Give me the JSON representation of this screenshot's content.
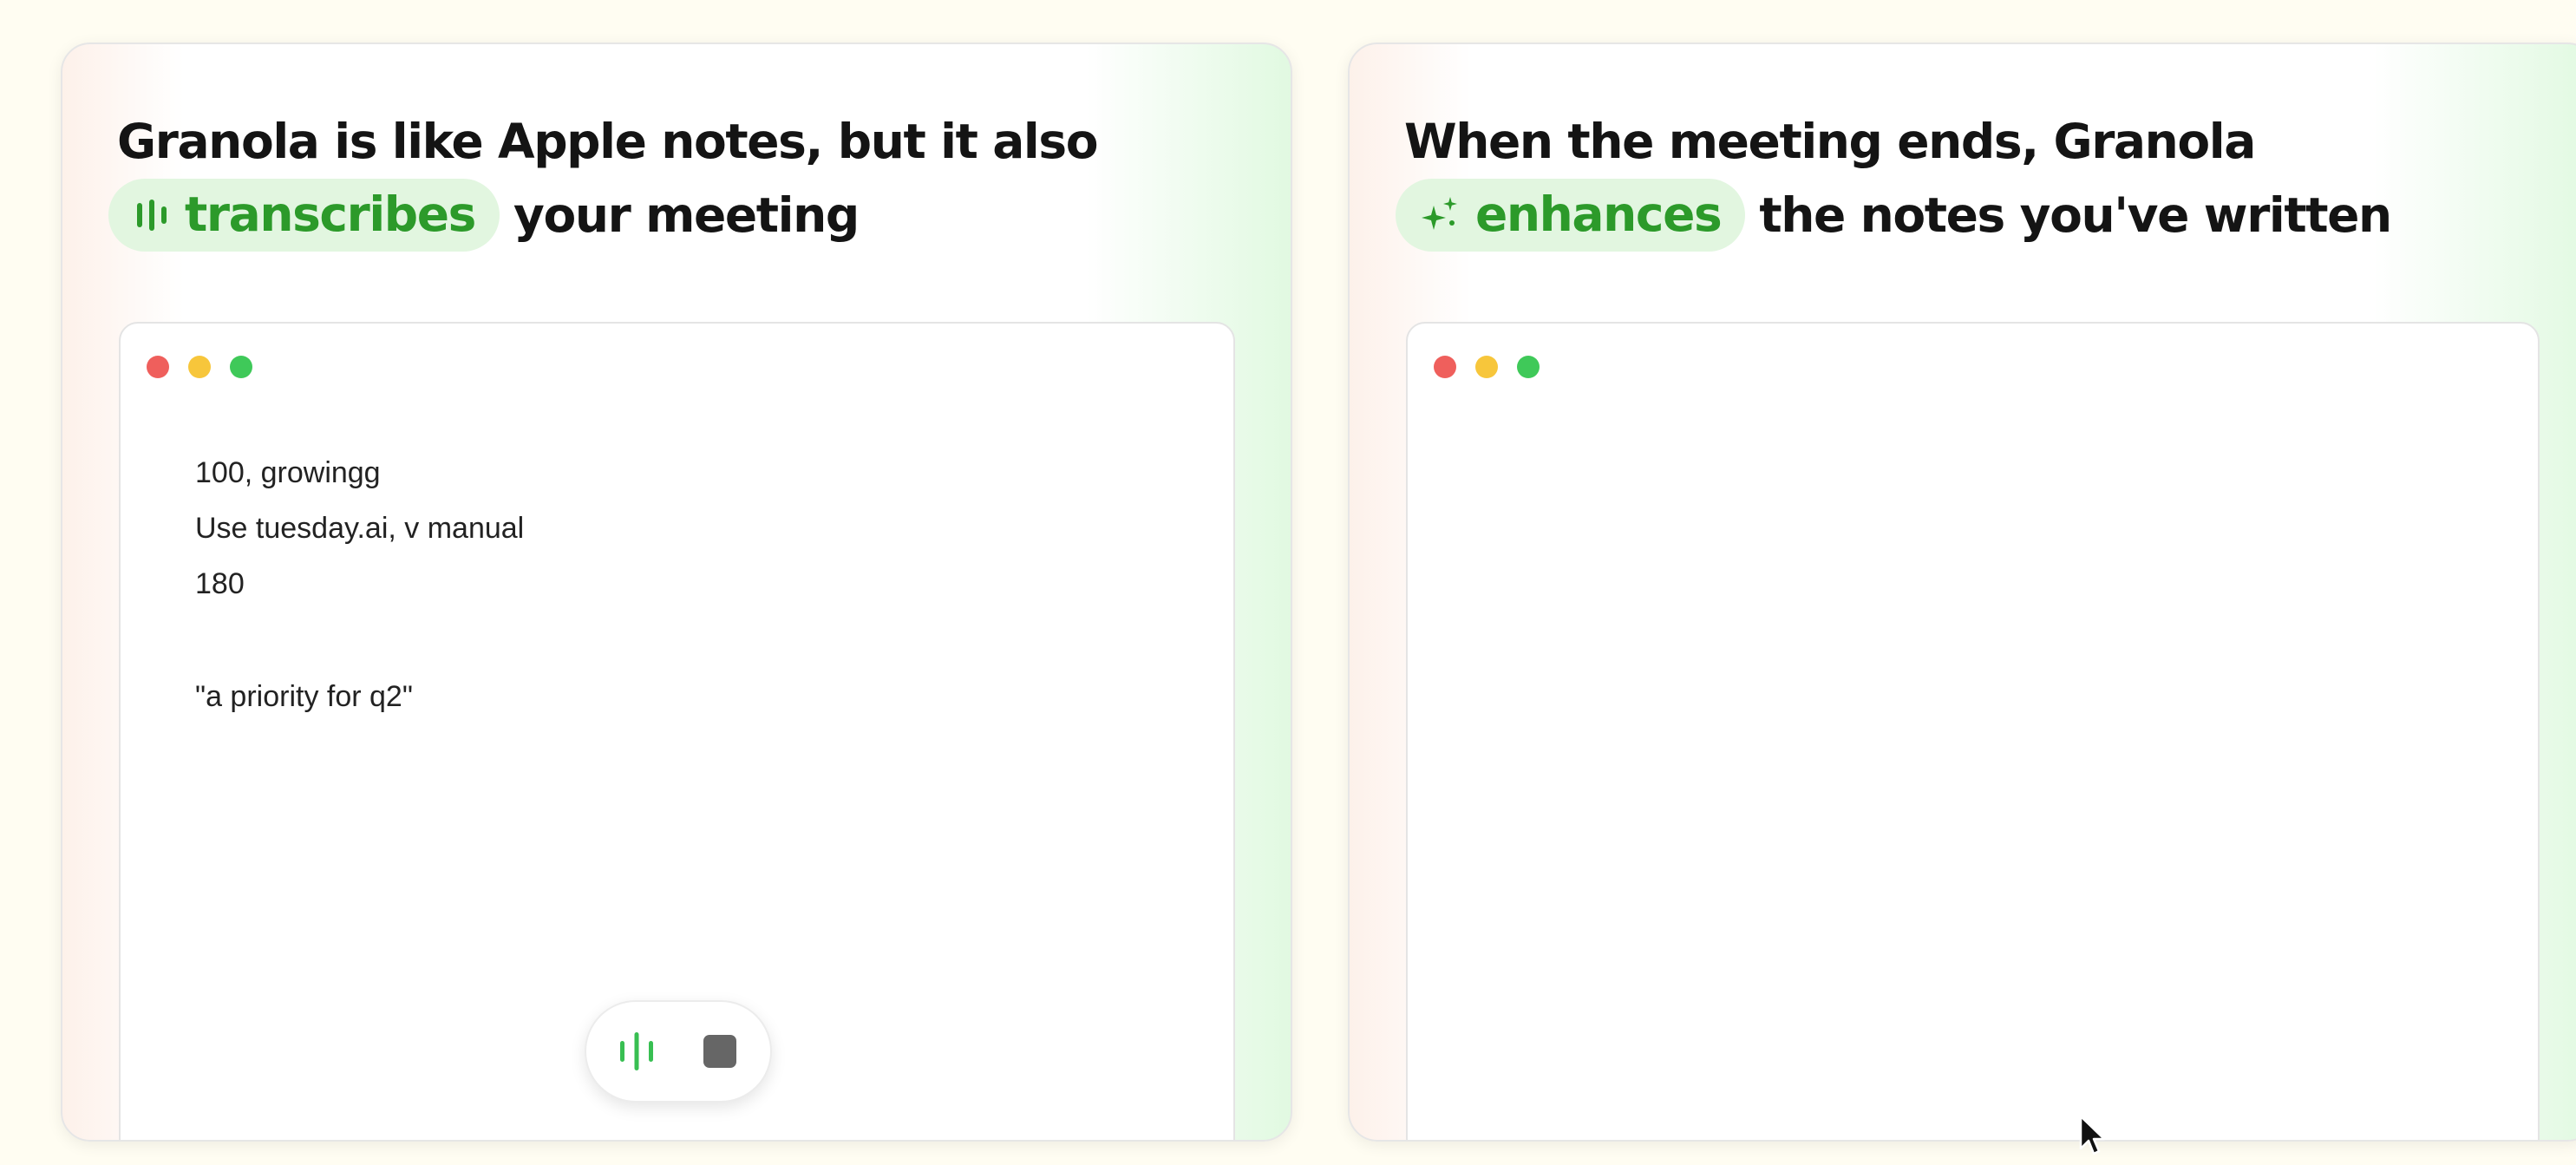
{
  "left_card": {
    "headline_line1": "Granola is like Apple notes, but it also",
    "pill_icon": "waveform-icon",
    "pill_label": "transcribes",
    "headline_line2_rest": "your meeting",
    "notes": [
      "100, growingg",
      "Use tuesday.ai, v manual",
      "180",
      "",
      "\"a priority for q2\""
    ],
    "controls": {
      "record_icon": "waveform-icon",
      "stop_icon": "stop-icon"
    }
  },
  "right_card": {
    "headline_line1": "When the meeting ends, Granola",
    "pill_icon": "sparkles-icon",
    "pill_label": "enhances",
    "headline_line2_rest": "the notes you've written"
  },
  "window_dots": [
    "#ef5f5c",
    "#f7c63b",
    "#3fc959"
  ],
  "colors": {
    "accent_green": "#2c9a2a",
    "pill_bg": "#e2f6e0",
    "text": "#141414"
  },
  "cursor_icon": "mouse-pointer-icon"
}
